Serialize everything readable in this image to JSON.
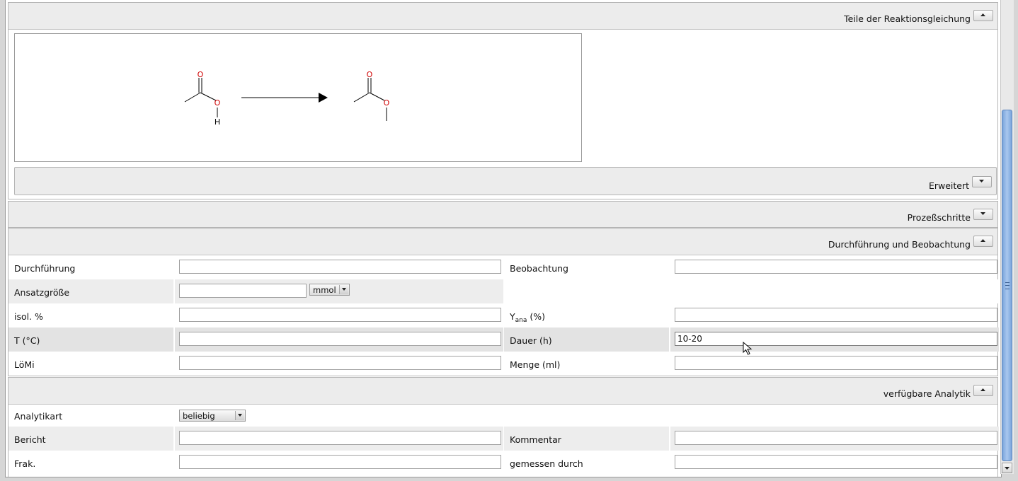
{
  "reaction_panel": {
    "title": "Teile der Reaktionsgleichung",
    "reactant_atoms": {
      "o1": "O",
      "o2": "O",
      "h": "H"
    },
    "product_atoms": {
      "o1": "O",
      "o2": "O"
    },
    "colors": {
      "oxygen": "#d00000",
      "bond": "#000000"
    }
  },
  "erweitert": {
    "title": "Erweitert"
  },
  "prozess": {
    "title": "Prozeßschritte"
  },
  "durchfuehrung": {
    "title": "Durchführung und Beobachtung",
    "durchfuehrung_label": "Durchführung",
    "durchfuehrung_value": "",
    "beobachtung_label": "Beobachtung",
    "beobachtung_value": "",
    "ansatz_label": "Ansatzgröße",
    "ansatz_value": "",
    "ansatz_unit": "mmol",
    "isol_label": "isol. %",
    "isol_value": "",
    "yana_main": "Y",
    "yana_sub": "ana",
    "yana_suffix": " (%)",
    "yana_value": "",
    "temp_label": "T (°C)",
    "temp_value": "",
    "dauer_label": "Dauer (h)",
    "dauer_value": "10-20",
    "loemi_label": "LöMi",
    "loemi_value": "",
    "menge_label": "Menge (ml)",
    "menge_value": ""
  },
  "analytik": {
    "title": "verfügbare Analytik",
    "art_label": "Analytikart",
    "art_value": "beliebig",
    "bericht_label": "Bericht",
    "bericht_value": "",
    "kommentar_label": "Kommentar",
    "kommentar_value": "",
    "frak_label": "Frak.",
    "frak_value": "",
    "gemessen_label": "gemessen durch",
    "gemessen_value": ""
  }
}
